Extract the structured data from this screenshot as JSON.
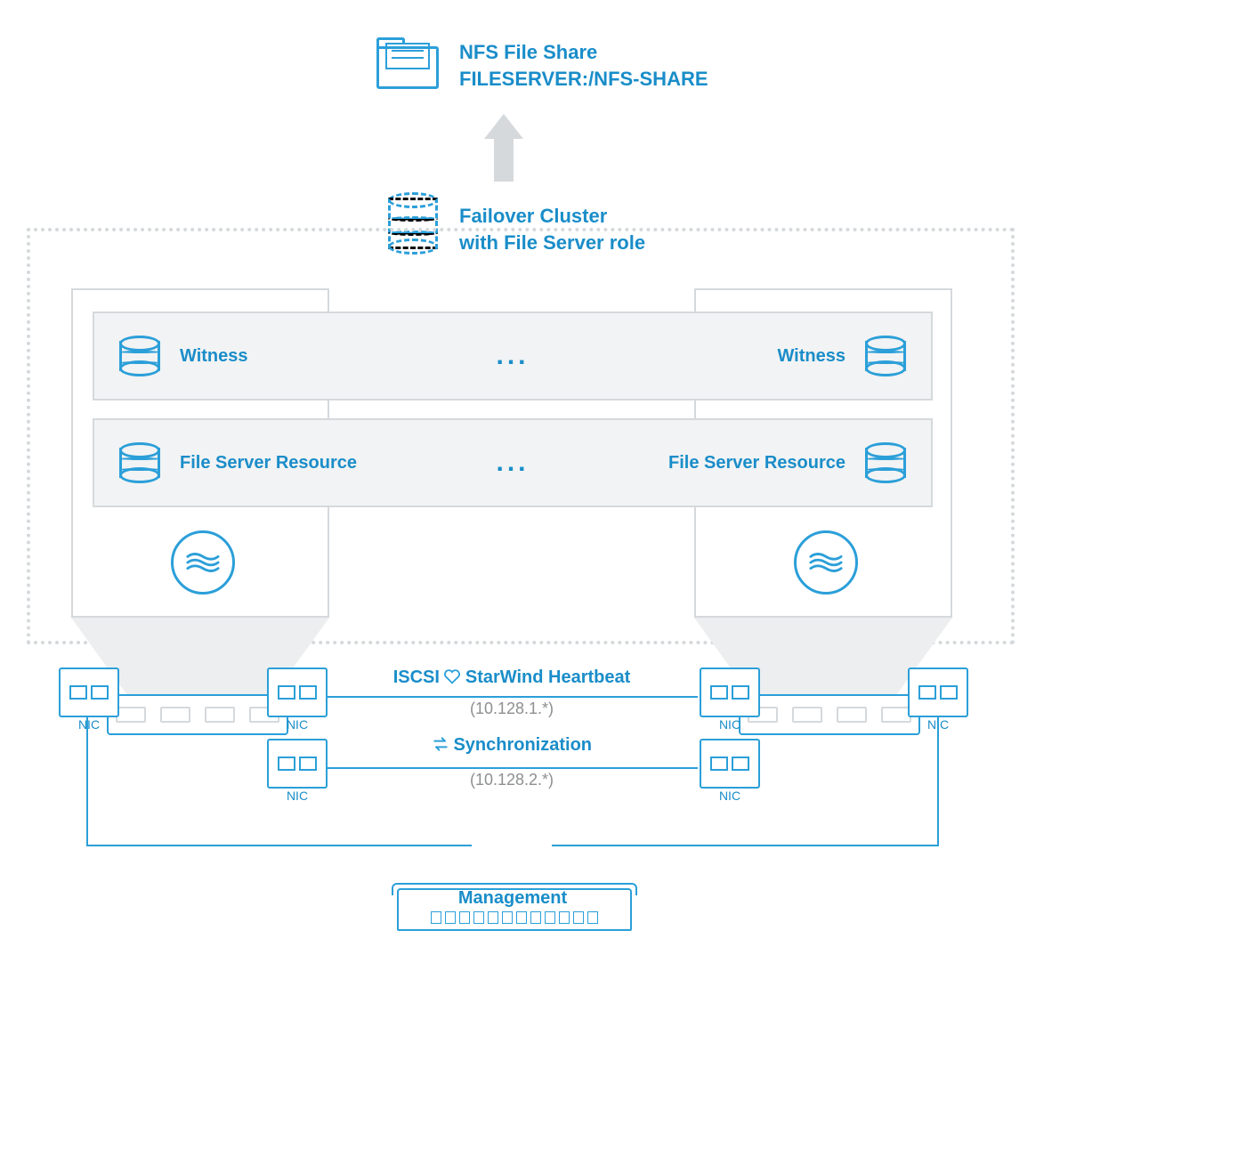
{
  "nfs": {
    "title": "NFS File Share",
    "path": "FILESERVER:/NFS-SHARE"
  },
  "cluster": {
    "title_l1": "Failover Cluster",
    "title_l2": "with File Server role"
  },
  "bars": {
    "witness_left": "Witness",
    "witness_right": "Witness",
    "witness_mid": "...",
    "fsr_left": "File Server Resource",
    "fsr_right": "File Server Resource",
    "fsr_mid": "..."
  },
  "links": {
    "iscsi_label": "ISCSI",
    "heartbeat_label": "StarWind Heartbeat",
    "iscsi_subnet": "(10.128.1.*)",
    "sync_label": "Synchronization",
    "sync_subnet": "(10.128.2.*)"
  },
  "management_label": "Management",
  "nic_label": "NIC"
}
